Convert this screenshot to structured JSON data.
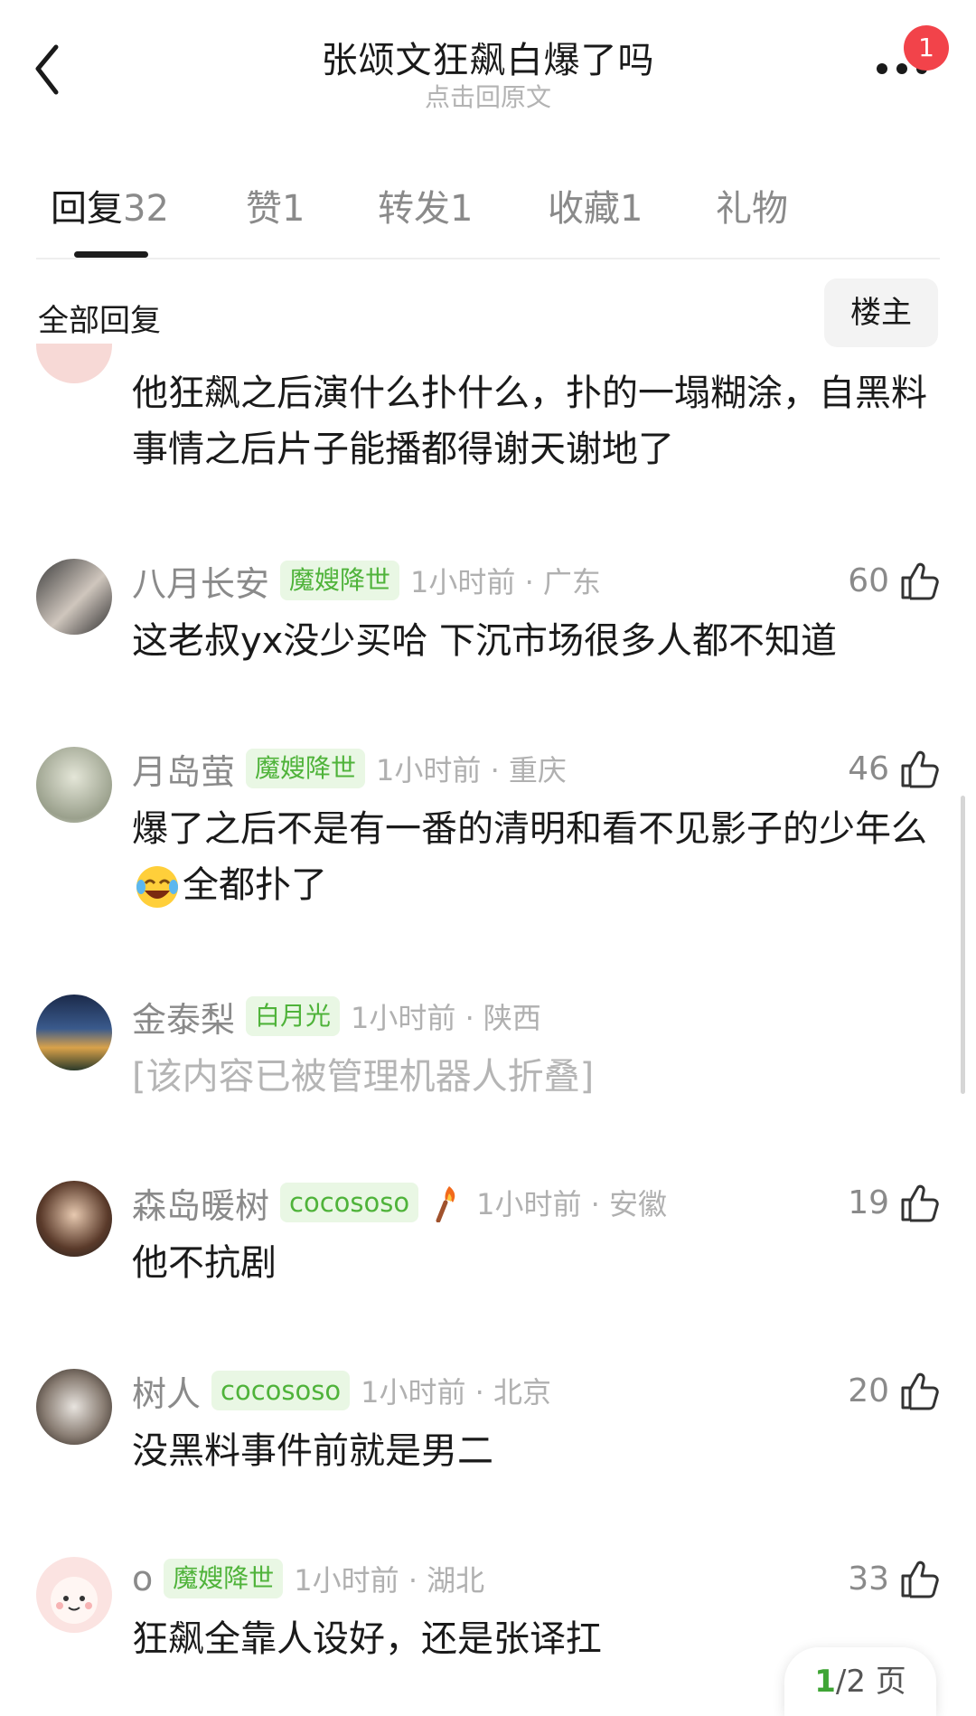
{
  "header": {
    "title": "张颂文狂飙白爆了吗",
    "subtitle": "点击回原文",
    "notification_count": "1"
  },
  "tabs": [
    {
      "label": "回复",
      "count": "32",
      "active": true
    },
    {
      "label": "赞",
      "count": "1"
    },
    {
      "label": "转发",
      "count": "1"
    },
    {
      "label": "收藏",
      "count": "1"
    },
    {
      "label": "礼物",
      "count": ""
    }
  ],
  "section": {
    "title": "全部回复",
    "filter_label": "楼主"
  },
  "comments": [
    {
      "text": "他狂飙之后演什么扑什么，扑的一塌糊涂，自黑料事情之后片子能播都得谢天谢地了"
    },
    {
      "username": "八月长安",
      "badge": "魔嫂降世",
      "time": "1小时前",
      "location": "广东",
      "likes": "60",
      "text": "这老叔yx没少买哈 下沉市场很多人都不知道"
    },
    {
      "username": "月岛萤",
      "badge": "魔嫂降世",
      "time": "1小时前",
      "location": "重庆",
      "likes": "46",
      "text_before": "爆了之后不是有一番的清明和看不见影子的少年么",
      "text_after": "全都扑了",
      "emoji": "laugh-crying"
    },
    {
      "username": "金泰梨",
      "badge": "白月光",
      "time": "1小时前",
      "location": "陕西",
      "text": "[该内容已被管理机器人折叠]"
    },
    {
      "username": "森岛暖树",
      "badge": "cocososo",
      "time": "1小时前",
      "location": "安徽",
      "likes": "19",
      "text": "他不抗剧"
    },
    {
      "username": "树人",
      "badge": "cocososo",
      "time": "1小时前",
      "location": "北京",
      "likes": "20",
      "text": "没黑料事件前就是男二"
    },
    {
      "username": "o",
      "badge": "魔嫂降世",
      "time": "1小时前",
      "location": "湖北",
      "likes": "33",
      "text": "狂飙全靠人设好，还是张译扛"
    }
  ],
  "pagination": {
    "current": "1",
    "total": "/2",
    "suffix": "页"
  },
  "colors": {
    "badge_green": "#4fb33a",
    "badge_bg": "#e9f7e4",
    "notification_red": "#f2434a",
    "page_current": "#3fa535"
  }
}
